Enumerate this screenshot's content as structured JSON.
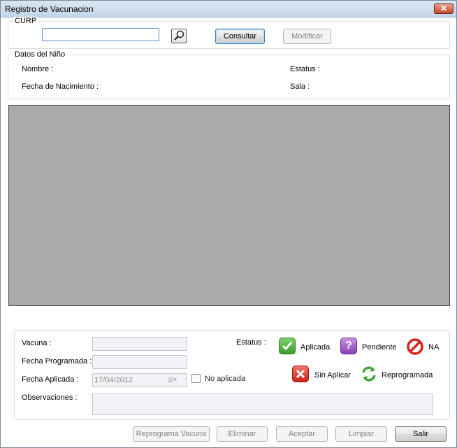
{
  "window": {
    "title": "Registro de Vacunacion",
    "close_icon": "close-icon"
  },
  "curp_group": {
    "legend": "CURP",
    "curp_value": "",
    "search_icon": "magnifier-icon",
    "consultar_label": "Consultar",
    "modificar_label": "Modificar"
  },
  "nino_group": {
    "legend": "Datos del Niño",
    "nombre_label": "Nombre :",
    "fecha_nacimiento_label": "Fecha de Nacimiento :",
    "estatus_label": "Estatus :",
    "sala_label": "Sala :"
  },
  "detalle": {
    "vacuna_label": "Vacuna :",
    "vacuna_value": "",
    "fecha_programada_label": "Fecha Programada :",
    "fecha_programada_value": "",
    "fecha_aplicada_label": "Fecha Aplicada :",
    "fecha_aplicada_value": "17/04/2012",
    "no_aplicada_label": "No aplicada",
    "no_aplicada_checked": false,
    "observaciones_label": "Observaciones :",
    "observaciones_value": "",
    "estatus_label": "Estatus :",
    "legend_items": [
      {
        "label": "Aplicada",
        "icon": "check-icon",
        "color": "#4caf3a"
      },
      {
        "label": "Pendiente",
        "icon": "question-icon",
        "color": "#9b4fc2"
      },
      {
        "label": "NA",
        "icon": "no-entry-icon",
        "color": "#d6241c"
      },
      {
        "label": "Sin Aplicar",
        "icon": "x-icon",
        "color": "#d9312a"
      },
      {
        "label": "Reprogramada",
        "icon": "arrows-cycle-icon",
        "color": "#3fa33a"
      }
    ]
  },
  "footer": {
    "reprograma_label": "Reprograma Vacuna",
    "eliminar_label": "Eliminar",
    "aceptar_label": "Aceptar",
    "limpiar_label": "Limpiar",
    "salir_label": "Salir"
  }
}
